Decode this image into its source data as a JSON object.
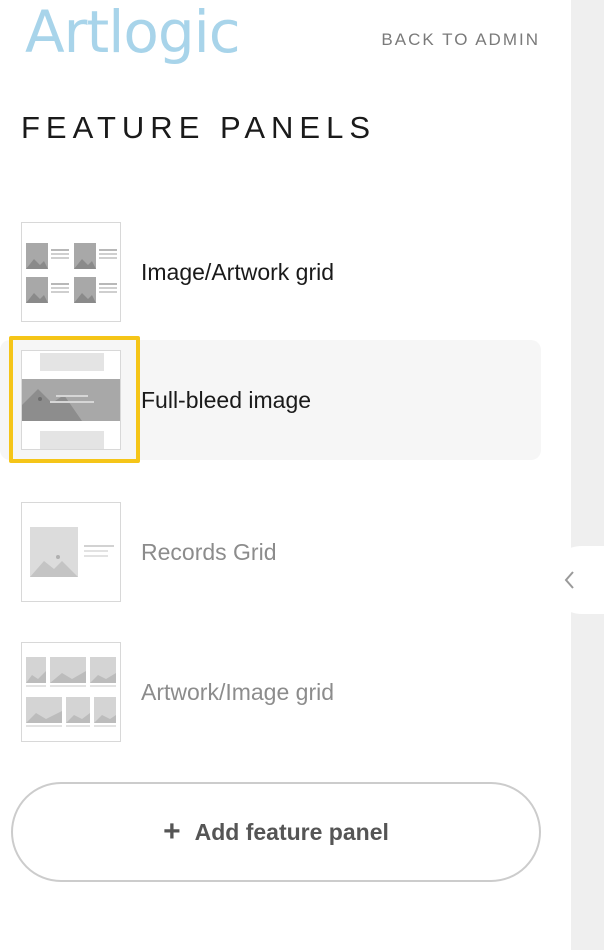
{
  "header": {
    "logo_text": "Artlogic",
    "back_link": "BACK TO ADMIN"
  },
  "page_title": "FEATURE PANELS",
  "panels": [
    {
      "label": "Image/Artwork grid",
      "state": "active",
      "thumbnail": "image-artwork-grid-thumbnail"
    },
    {
      "label": "Full-bleed image",
      "state": "selected",
      "thumbnail": "full-bleed-image-thumbnail"
    },
    {
      "label": "Records Grid",
      "state": "muted",
      "thumbnail": "records-grid-thumbnail"
    },
    {
      "label": "Artwork/Image grid",
      "state": "muted",
      "thumbnail": "artwork-image-grid-thumbnail"
    }
  ],
  "add_button": {
    "icon": "plus-icon",
    "label": "Add feature panel"
  },
  "sidebar_toggle": {
    "icon": "chevron-left-icon"
  },
  "colors": {
    "logo": "#a8d4ea",
    "highlight": "#f5c518",
    "selected_row": "#f6f6f6",
    "muted_text": "#8c8c8c"
  }
}
